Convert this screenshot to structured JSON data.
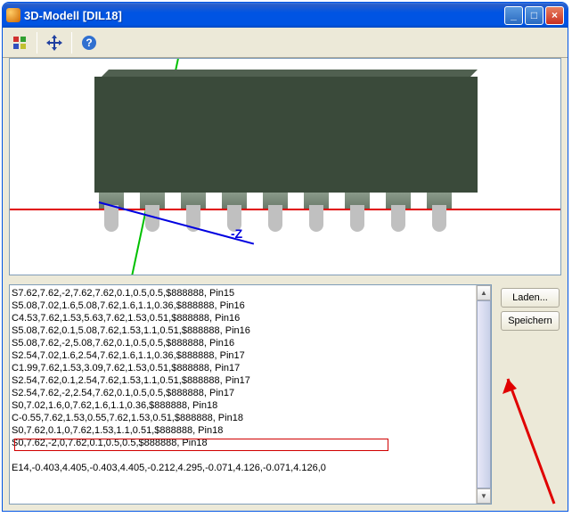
{
  "window": {
    "title": "3D-Modell  [DIL18]",
    "minimize": "_",
    "maximize": "□",
    "close": "×"
  },
  "toolbar": {
    "icon1": "axes-color-icon",
    "icon2": "axes-move-icon",
    "icon3": "help-icon"
  },
  "viewport": {
    "axis_label": "-Z"
  },
  "text_lines": [
    "S7.62,7.62,-2,7.62,7.62,0.1,0.5,0.5,$888888, Pin15",
    "S5.08,7.02,1.6,5.08,7.62,1.6,1.1,0.36,$888888, Pin16",
    "C4.53,7.62,1.53,5.63,7.62,1.53,0.51,$888888, Pin16",
    "S5.08,7.62,0.1,5.08,7.62,1.53,1.1,0.51,$888888, Pin16",
    "S5.08,7.62,-2,5.08,7.62,0.1,0.5,0.5,$888888, Pin16",
    "S2.54,7.02,1.6,2.54,7.62,1.6,1.1,0.36,$888888, Pin17",
    "C1.99,7.62,1.53,3.09,7.62,1.53,0.51,$888888, Pin17",
    "S2.54,7.62,0.1,2.54,7.62,1.53,1.1,0.51,$888888, Pin17",
    "S2.54,7.62,-2,2.54,7.62,0.1,0.5,0.5,$888888, Pin17",
    "S0,7.02,1.6,0,7.62,1.6,1.1,0.36,$888888, Pin18",
    "C-0.55,7.62,1.53,0.55,7.62,1.53,0.51,$888888, Pin18",
    "S0,7.62,0.1,0,7.62,1.53,1.1,0.51,$888888, Pin18",
    "S0,7.62,-2,0,7.62,0.1,0.5,0.5,$888888, Pin18",
    "",
    "E14,-0.403,4.405,-0.403,4.405,-0.212,4.295,-0.071,4.126,-0.071,4.126,0"
  ],
  "sidebar": {
    "load": "Laden...",
    "save": "Speichern"
  }
}
